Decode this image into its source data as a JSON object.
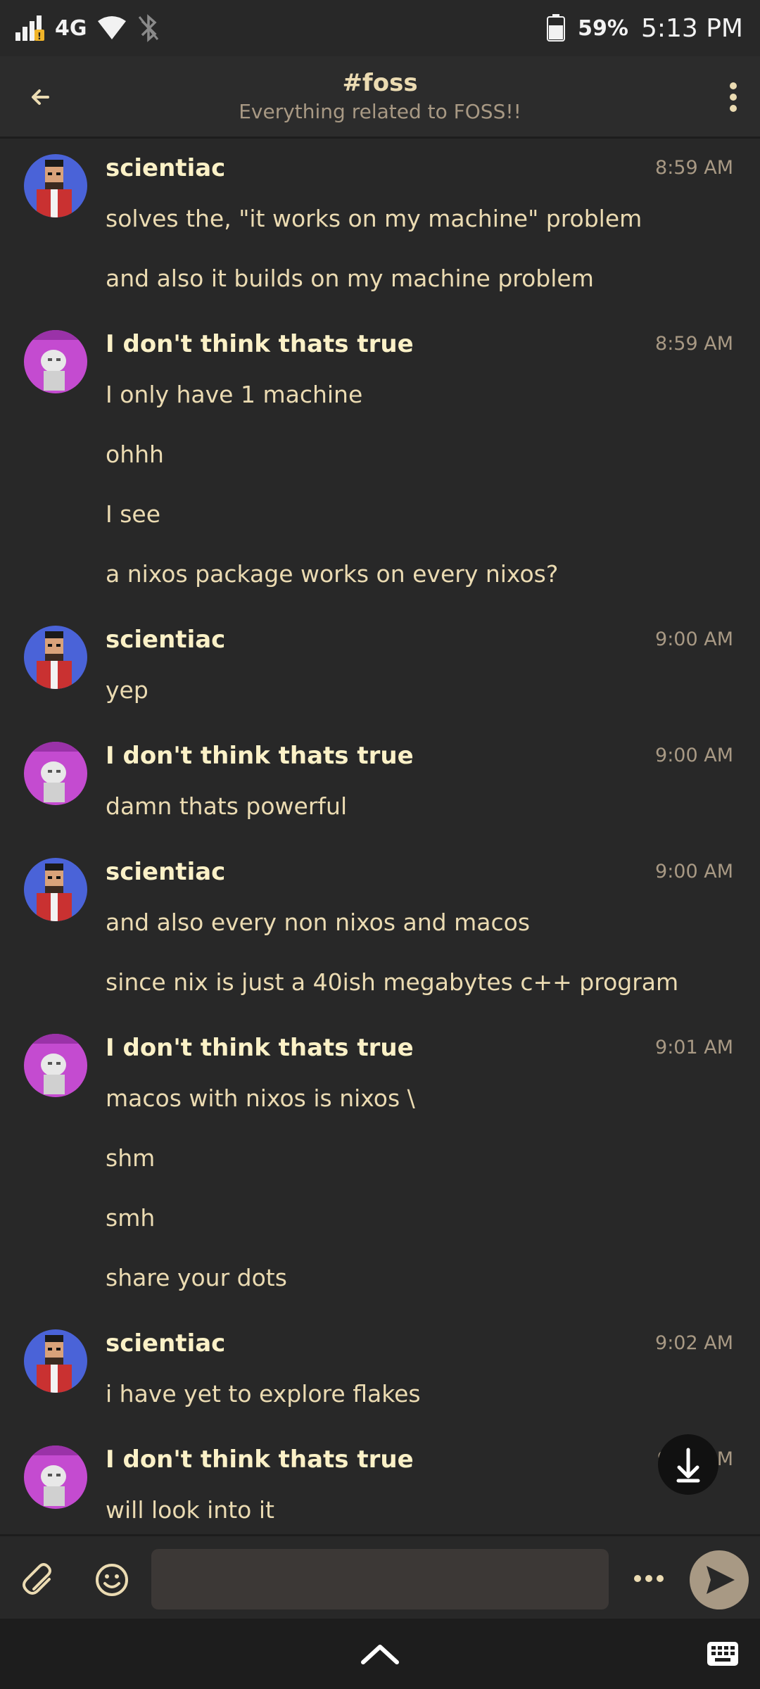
{
  "status_bar": {
    "network": "4G",
    "battery": "59%",
    "time": "5:13 PM"
  },
  "header": {
    "title": "#foss",
    "subtitle": "Everything related to FOSS!!"
  },
  "users": {
    "scientiac": {
      "name": "scientiac",
      "avatar_icon": "pixel-art-avatar-icon"
    },
    "other": {
      "name": "I don't think thats true",
      "avatar_icon": "anime-avatar-icon"
    }
  },
  "messages": [
    {
      "author": "scientiac",
      "time": "8:59 AM",
      "lines": [
        "solves the, \"it works on my machine\" problem",
        "and also it builds on my machine problem"
      ]
    },
    {
      "author": "I don't think thats true",
      "time": "8:59 AM",
      "lines": [
        "I only have 1 machine",
        "ohhh",
        "I see",
        "a nixos package works on every nixos?"
      ]
    },
    {
      "author": "scientiac",
      "time": "9:00 AM",
      "lines": [
        "yep"
      ]
    },
    {
      "author": "I don't think thats true",
      "time": "9:00 AM",
      "lines": [
        "damn thats powerful"
      ]
    },
    {
      "author": "scientiac",
      "time": "9:00 AM",
      "lines": [
        "and also every non nixos and macos",
        "since nix is just a 40ish megabytes c++ program"
      ]
    },
    {
      "author": "I don't think thats true",
      "time": "9:01 AM",
      "lines": [
        "macos with nixos is nixos \\",
        "shm",
        "smh",
        "share your dots"
      ]
    },
    {
      "author": "scientiac",
      "time": "9:02 AM",
      "lines": [
        "i have yet to explore flakes"
      ]
    },
    {
      "author": "I don't think thats true",
      "time": "9:0? AM",
      "lines": [
        "will look into it"
      ]
    }
  ],
  "composer": {
    "placeholder": "",
    "value": ""
  },
  "colors": {
    "background": "#282828",
    "text": "#ebdbb2",
    "muted": "#a89984",
    "avatar_a": "#4a63d8",
    "avatar_b": "#c44bd0"
  }
}
